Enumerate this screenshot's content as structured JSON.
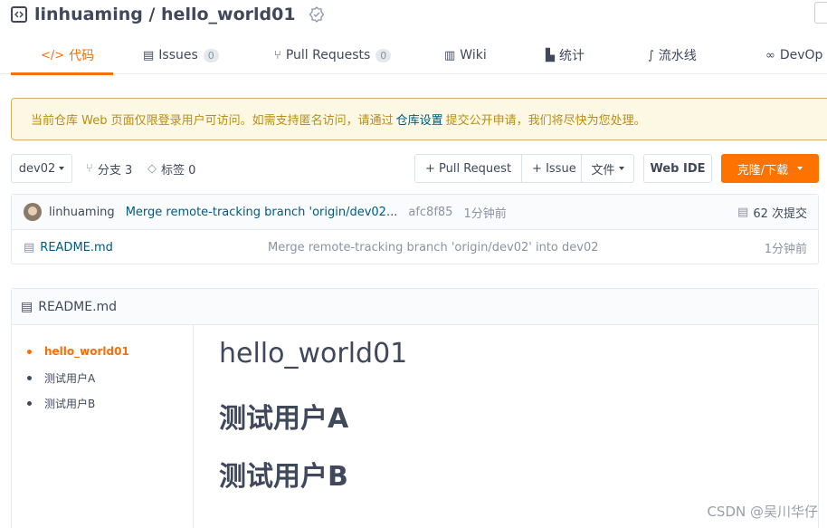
{
  "repo": {
    "title": "linhuaming / hello_world01"
  },
  "tabs": [
    {
      "label": "代码",
      "icon": "code-icon"
    },
    {
      "label": "Issues",
      "count": "0",
      "icon": "issues-icon"
    },
    {
      "label": "Pull Requests",
      "count": "0",
      "icon": "pull-request-icon"
    },
    {
      "label": "Wiki",
      "icon": "wiki-icon"
    },
    {
      "label": "统计",
      "icon": "stats-icon"
    },
    {
      "label": "流水线",
      "icon": "pipeline-icon"
    },
    {
      "label": "DevOp",
      "icon": "devops-icon"
    }
  ],
  "notice": {
    "text_before": "当前仓库 Web 页面仅限登录用户可访问。如需支持匿名访问，请通过",
    "link": "仓库设置",
    "text_after": "提交公开申请，我们将尽快为您处理。"
  },
  "toolbar": {
    "branch": "dev02",
    "branches": "分支 3",
    "tags": "标签 0",
    "pull_request": "+ Pull Request",
    "issue": "+ Issue",
    "file": "文件",
    "web_ide": "Web IDE",
    "clone": "克隆/下载"
  },
  "commit": {
    "author": "linhuaming",
    "message": "Merge remote-tracking branch 'origin/dev02...",
    "hash": "afc8f85",
    "time": "1分钟前",
    "total": "62 次提交"
  },
  "files": [
    {
      "name": "README.md",
      "message": "Merge remote-tracking branch 'origin/dev02' into dev02",
      "time": "1分钟前"
    }
  ],
  "readme": {
    "title": "README.md",
    "toc": [
      "hello_world01",
      "测试用户A",
      "测试用户B"
    ],
    "h1": "hello_world01",
    "h2a": "测试用户A",
    "h2b": "测试用户B"
  },
  "watermark": "CSDN @吴川华仔",
  "colors": {
    "accent": "#f66f0a",
    "primary_button": "#fe7300",
    "link": "#005980"
  }
}
